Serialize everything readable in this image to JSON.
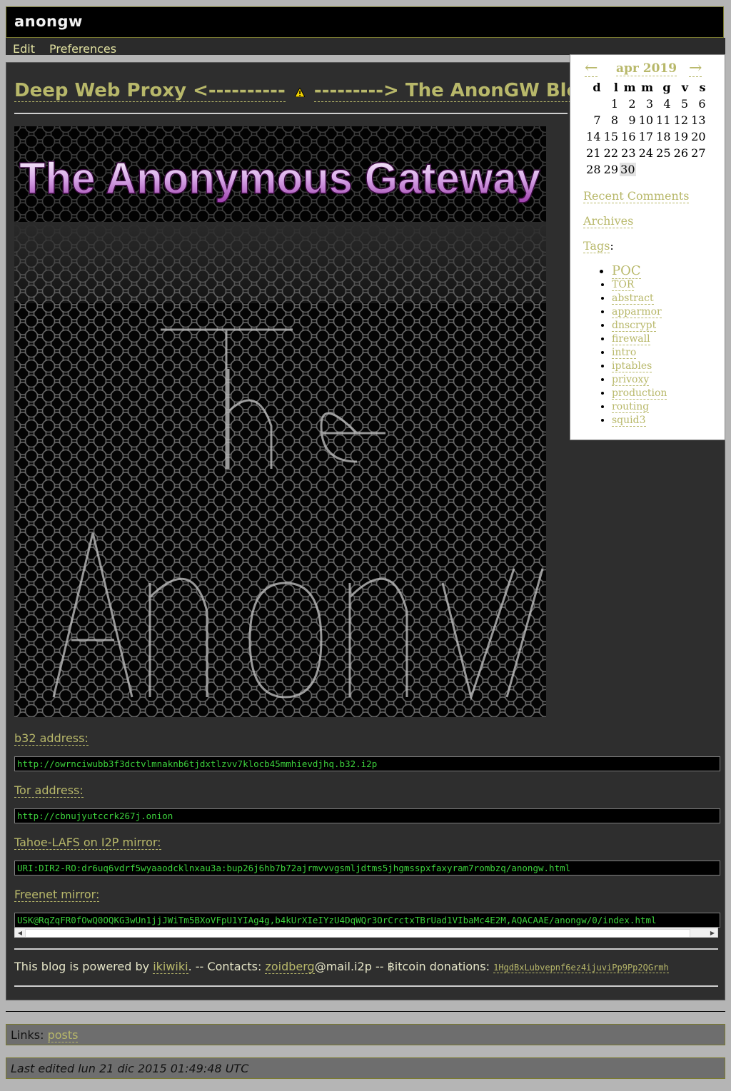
{
  "header": {
    "site_title": "anongw"
  },
  "actions": {
    "edit": "Edit",
    "preferences": "Preferences"
  },
  "page": {
    "title_left": "Deep Web Proxy <----------",
    "title_right": "---------> The AnonGW Blog",
    "banner_text": "The Anonymous Gateway",
    "sections": [
      {
        "label": "b32 address:",
        "value": "http://owrnciwubb3f3dctvlmnaknb6tjdxtlzvv7klocb45mmhievdjhq.b32.i2p"
      },
      {
        "label": "Tor address:",
        "value": "http://cbnujyutccrk267j.onion"
      },
      {
        "label": "Tahoe-LAFS on I2P mirror:",
        "value": "URI:DIR2-RO:dr6uq6vdrf5wyaaodcklnxau3a:bup26j6hb7b72ajrmvvvgsmljdtms5jhgmsspxfaxyram7rombzq/anongw.html"
      },
      {
        "label": "Freenet mirror:",
        "value": "USK@RqZqFR0fOwQ0OQKG3wUn1jjJWiTm5BXoVFpU1YIAg4g,b4kUrXIeIYzU4DqWQr3OrCrctxTBrUad1VIbaMc4E2M,AQACAAE/anongw/0/index.html"
      }
    ],
    "footer": {
      "powered_prefix": "This blog is powered by ",
      "ikiwiki": "ikiwiki",
      "contacts_prefix": ". -- Contacts: ",
      "contact_user": "zoidberg",
      "contact_domain": "@mail.i2p -- ",
      "bitcoin_label": "฿itcoin donations: ",
      "bitcoin_address": "1HgdBxLubvepnf6ez4ijuviPp9Pp2QGrmh"
    }
  },
  "sidebar": {
    "calendar": {
      "prev": "←",
      "next": "→",
      "month": "apr 2019",
      "weekdays": [
        "d",
        "l",
        "m",
        "m",
        "g",
        "v",
        "s"
      ],
      "weeks": [
        [
          "",
          "1",
          "2",
          "3",
          "4",
          "5",
          "6"
        ],
        [
          "7",
          "8",
          "9",
          "10",
          "11",
          "12",
          "13"
        ],
        [
          "14",
          "15",
          "16",
          "17",
          "18",
          "19",
          "20"
        ],
        [
          "21",
          "22",
          "23",
          "24",
          "25",
          "26",
          "27"
        ],
        [
          "28",
          "29",
          "30",
          "",
          "",
          "",
          ""
        ]
      ],
      "today": "30"
    },
    "recent_comments": "Recent Comments",
    "archives": "Archives",
    "tags_label": "Tags",
    "tags_colon": ":",
    "tags": [
      "POC",
      "TOR",
      "abstract",
      "apparmor",
      "dnscrypt",
      "firewall",
      "intro",
      "iptables",
      "privoxy",
      "production",
      "routing",
      "squid3"
    ]
  },
  "bottom": {
    "links_label": "Links: ",
    "links_value": "posts",
    "last_edited": "Last edited lun 21 dic 2015 01:49:48 UTC"
  },
  "colors": {
    "link": "#b8b86a",
    "code_text": "#3ccf3c",
    "content_bg": "#2e2e2e",
    "page_bg": "#b5b5b5"
  }
}
